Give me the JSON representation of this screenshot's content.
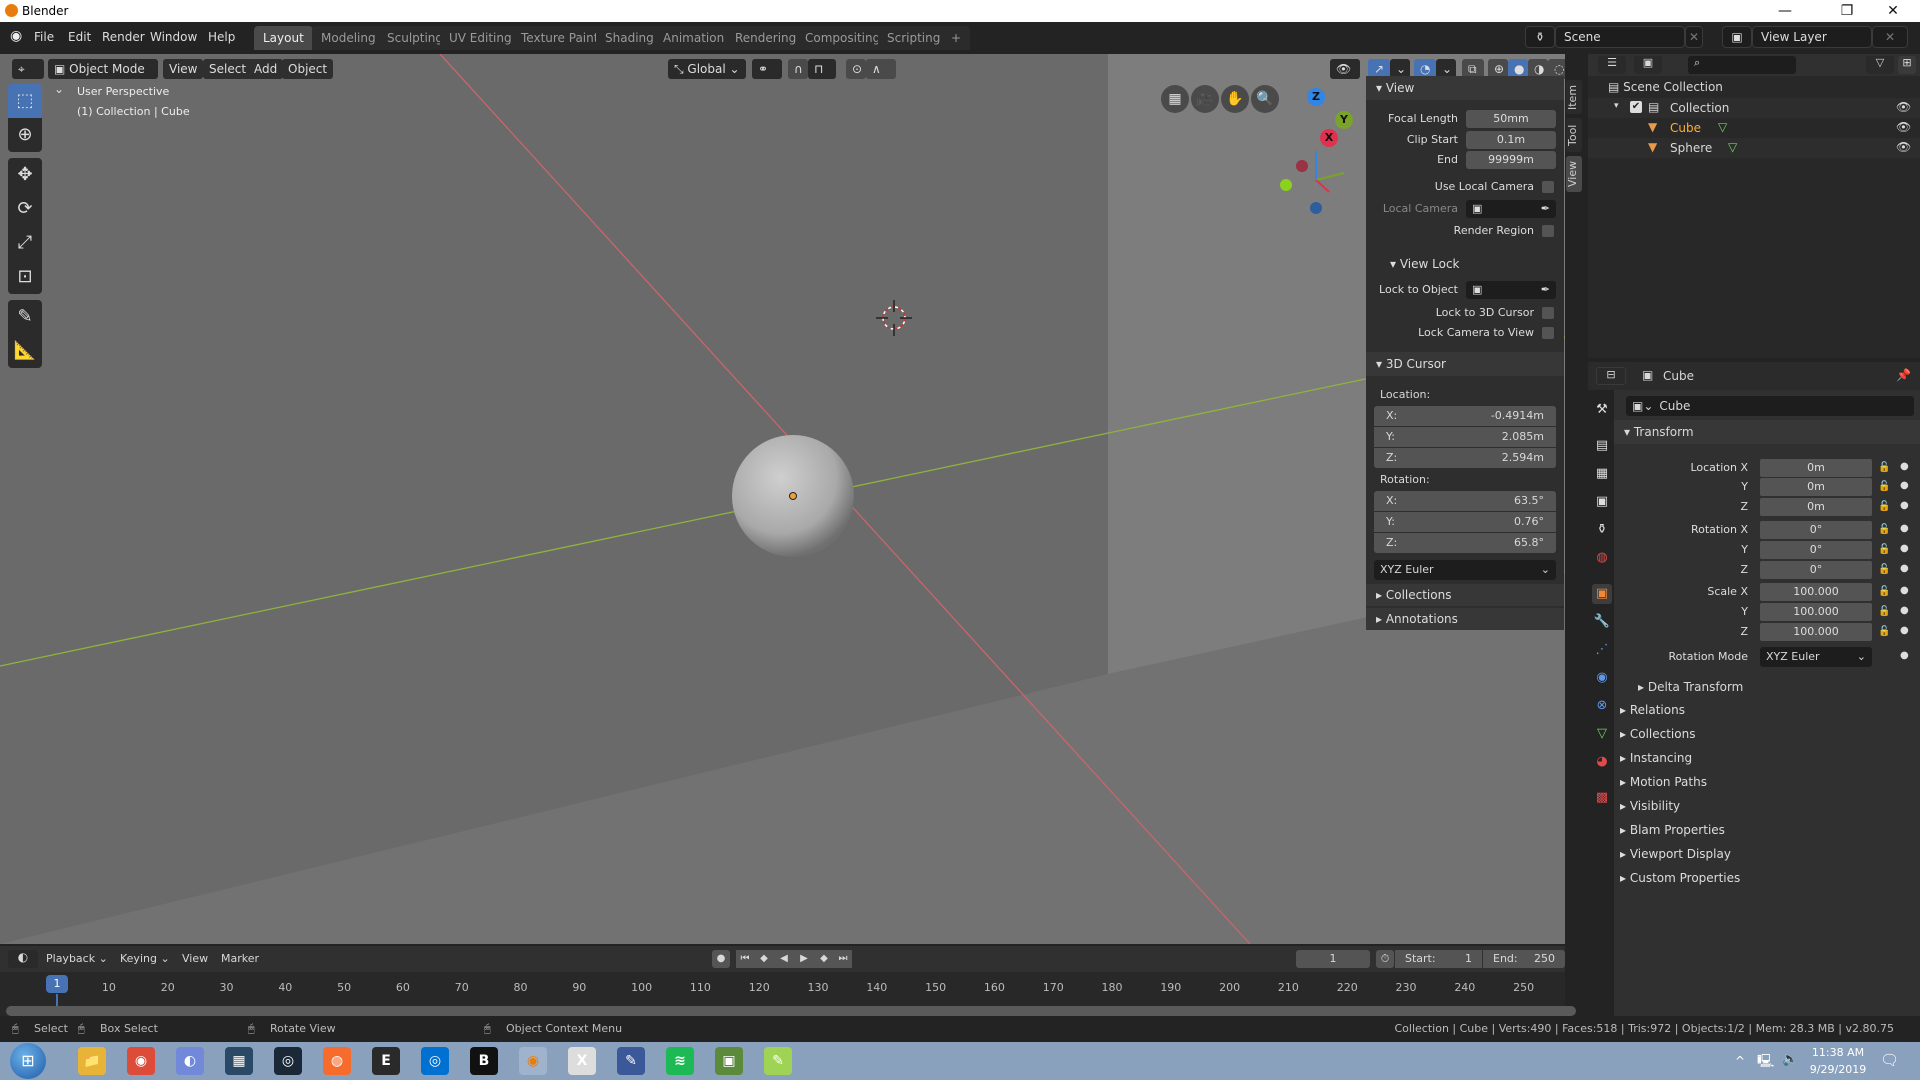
{
  "window": {
    "title": "Blender",
    "minimize": "—",
    "maximize": "❐",
    "close": "✕"
  },
  "menu": [
    "File",
    "Edit",
    "Render",
    "Window",
    "Help"
  ],
  "workspaces": [
    {
      "label": "Layout",
      "active": true
    },
    {
      "label": "Modeling"
    },
    {
      "label": "Sculpting"
    },
    {
      "label": "UV Editing"
    },
    {
      "label": "Texture Paint"
    },
    {
      "label": "Shading"
    },
    {
      "label": "Animation"
    },
    {
      "label": "Rendering"
    },
    {
      "label": "Compositing"
    },
    {
      "label": "Scripting"
    }
  ],
  "add_workspace": "+",
  "scene": {
    "value": "Scene",
    "view_layer": "View Layer"
  },
  "viewport": {
    "mode": "Object Mode",
    "menus": [
      "View",
      "Select",
      "Add",
      "Object"
    ],
    "transform_orientation": "Global",
    "overlay_text": [
      "User Perspective",
      "(1) Collection | Cube"
    ],
    "gizmo_axes": {
      "x": "X",
      "y": "Y",
      "z": "Z"
    },
    "colors": {
      "x": "#e0314e",
      "y": "#7aa32a",
      "z": "#2f86e8",
      "accent": "#4772b3"
    }
  },
  "npanel": {
    "tabs": [
      "Item",
      "Tool",
      "View"
    ],
    "view": {
      "title": "View",
      "focal_length_label": "Focal Length",
      "focal_length": "50mm",
      "clip_start_label": "Clip Start",
      "clip_start": "0.1m",
      "end_label": "End",
      "end": "99999m",
      "use_local_camera": "Use Local Camera",
      "local_camera": "Local Camera",
      "render_region": "Render Region"
    },
    "view_lock": {
      "title": "View Lock",
      "lock_to_object": "Lock to Object",
      "lock_to_cursor": "Lock to 3D Cursor",
      "lock_camera": "Lock Camera to View"
    },
    "cursor": {
      "title": "3D Cursor",
      "location_label": "Location:",
      "location": [
        {
          "axis": "X:",
          "value": "-0.4914m"
        },
        {
          "axis": "Y:",
          "value": "2.085m"
        },
        {
          "axis": "Z:",
          "value": "2.594m"
        }
      ],
      "rotation_label": "Rotation:",
      "rotation": [
        {
          "axis": "X:",
          "value": "63.5°"
        },
        {
          "axis": "Y:",
          "value": "0.76°"
        },
        {
          "axis": "Z:",
          "value": "65.8°"
        }
      ],
      "rotation_mode": "XYZ Euler"
    },
    "collapsed": [
      "Collections",
      "Annotations"
    ]
  },
  "outliner": {
    "root": "Scene Collection",
    "collection": "Collection",
    "objects": [
      {
        "name": "Cube",
        "selected": true
      },
      {
        "name": "Sphere",
        "selected": false
      }
    ]
  },
  "properties": {
    "header_object": "Cube",
    "object_name": "Cube",
    "transform_title": "Transform",
    "rows": [
      {
        "label": "Location X",
        "value": "0m"
      },
      {
        "label": "Y",
        "value": "0m"
      },
      {
        "label": "Z",
        "value": "0m"
      },
      {
        "label": "Rotation X",
        "value": "0°"
      },
      {
        "label": "Y",
        "value": "0°"
      },
      {
        "label": "Z",
        "value": "0°"
      },
      {
        "label": "Scale X",
        "value": "100.000"
      },
      {
        "label": "Y",
        "value": "100.000"
      },
      {
        "label": "Z",
        "value": "100.000"
      }
    ],
    "rotation_mode_label": "Rotation Mode",
    "rotation_mode": "XYZ Euler",
    "delta": "Delta Transform",
    "sections": [
      "Relations",
      "Collections",
      "Instancing",
      "Motion Paths",
      "Visibility",
      "Blam Properties",
      "Viewport Display",
      "Custom Properties"
    ]
  },
  "timeline": {
    "menus": [
      "Playback",
      "Keying",
      "View",
      "Marker"
    ],
    "current_frame": "1",
    "start_label": "Start:",
    "start": "1",
    "end_label": "End:",
    "end": "250",
    "ticks": [
      "10",
      "20",
      "30",
      "40",
      "50",
      "60",
      "70",
      "80",
      "90",
      "100",
      "110",
      "120",
      "130",
      "140",
      "150",
      "160",
      "170",
      "180",
      "190",
      "200",
      "210",
      "220",
      "230",
      "240",
      "250"
    ],
    "playhead": "1"
  },
  "statusbar": {
    "hints": [
      "Select",
      "Box Select",
      "Rotate View",
      "Object Context Menu"
    ],
    "stats": "Collection | Cube | Verts:490 | Faces:518 | Tris:972 | Objects:1/2 | Mem: 28.3 MB | v2.80.75"
  },
  "taskbar": {
    "apps": [
      "File Explorer",
      "Chrome",
      "Discord",
      "Unknown",
      "Steam",
      "Origin",
      "Epic Games",
      "Uplay",
      "Bethesda",
      "Blender",
      "HxD",
      "Editor",
      "Spotify",
      "Minecraft",
      "Notepad++"
    ],
    "time": "11:38 AM",
    "date": "9/29/2019"
  }
}
